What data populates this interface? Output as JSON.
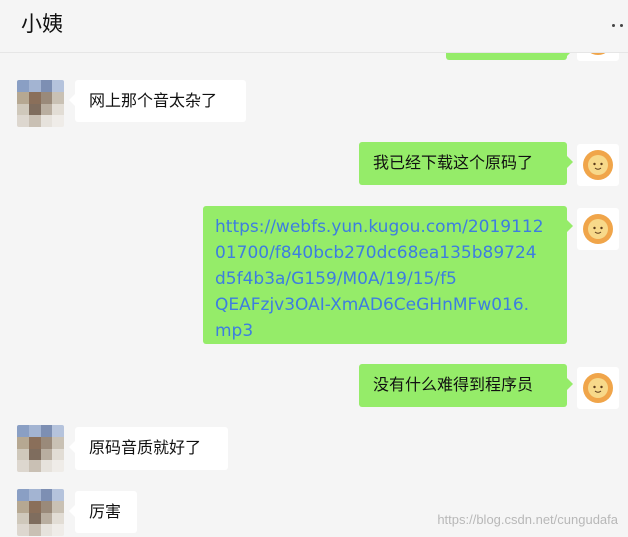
{
  "chat": {
    "title": "小姨"
  },
  "messages": [
    {
      "side": "in",
      "text": "网上那个音太杂了"
    },
    {
      "side": "out",
      "text": "我已经下载这个原码了"
    },
    {
      "side": "out",
      "text": "https://webfs.yun.kugou.com/20191120 1700/f840bcb270dc68ea135b89724d5f4b3a/G159/M0A/19/15/f5QEAFzjv3OAI-XmAD6CeGHnMFw016.mp3",
      "lines": [
        "https://webfs.yun.kugou.com/2019112",
        "01700/f840bcb270dc68ea135b89724",
        "d5f4b3a/G159/M0A/19/15/f5",
        "QEAFzjv3OAI-XmAD6CeGHnMFw016.",
        "mp3"
      ]
    },
    {
      "side": "out",
      "text": "没有什么难得到程序员"
    },
    {
      "side": "in",
      "text": "原码音质就好了"
    },
    {
      "side": "in",
      "text": "厉害"
    }
  ],
  "watermark": "https://blog.csdn.net/cungudafa",
  "colors": {
    "background": "#f5f5f5",
    "outgoing_bubble": "#95ec69",
    "incoming_bubble": "#ffffff",
    "link": "#3d7de0"
  },
  "icons": {
    "more": "more-dots-icon",
    "incoming_avatar": "pixelated-avatar",
    "outgoing_avatar": "lion-avatar"
  }
}
